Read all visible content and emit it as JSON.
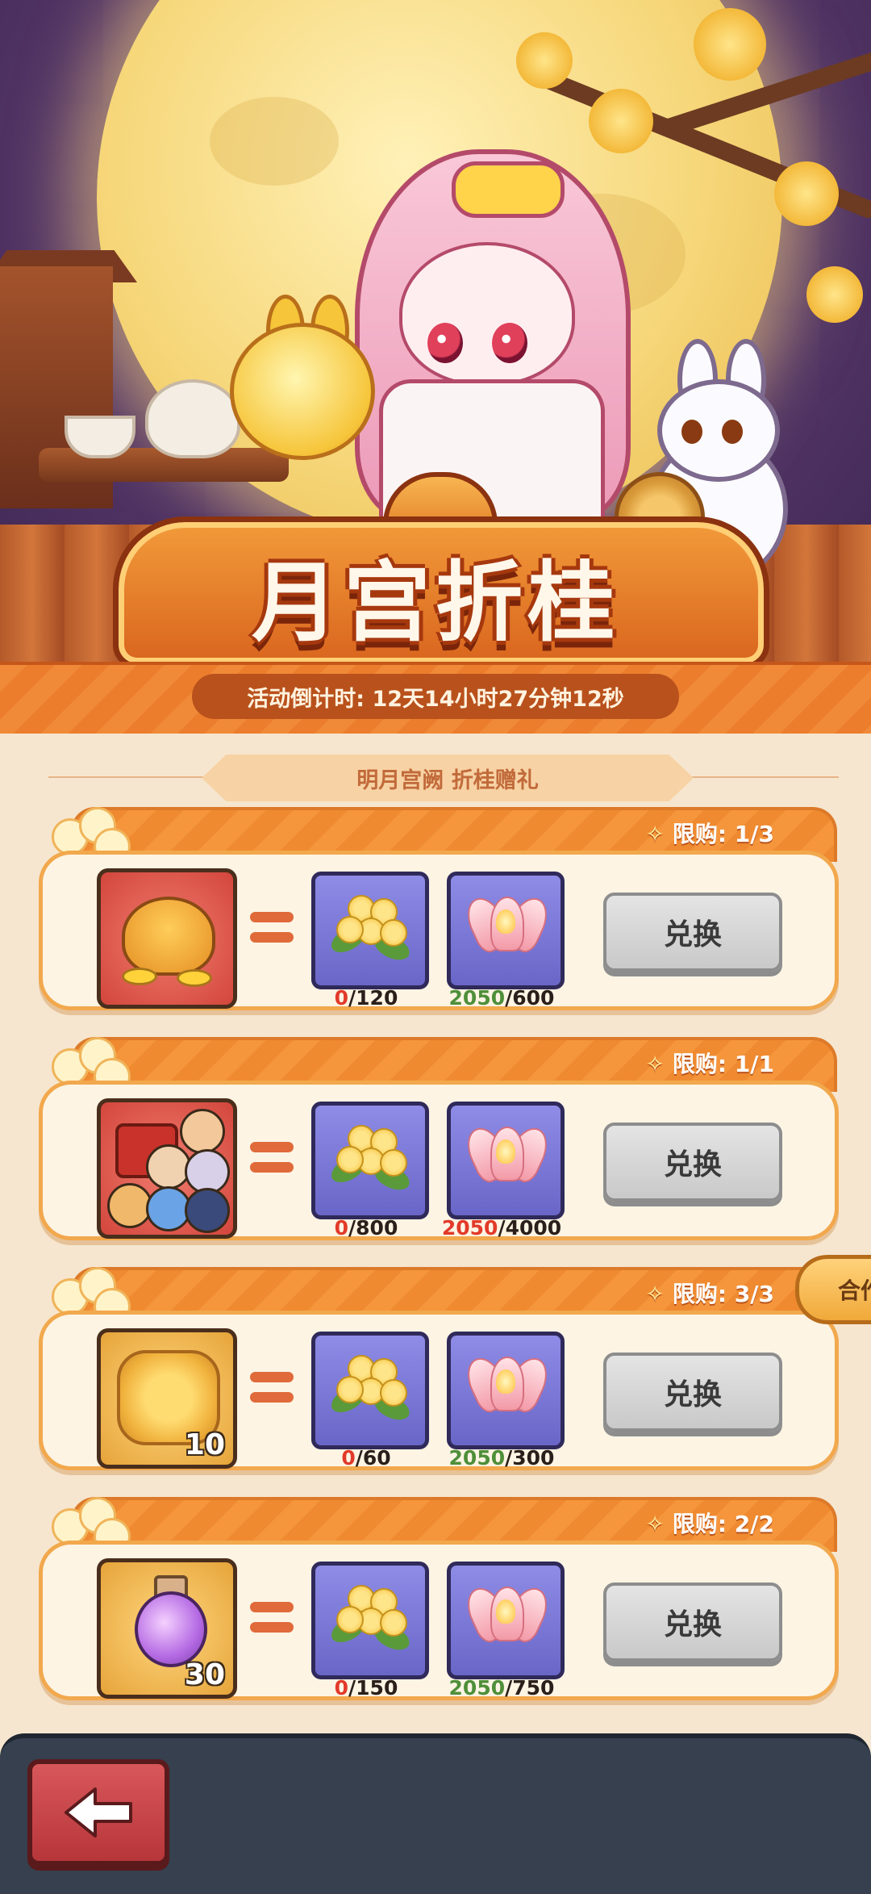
{
  "banner": {
    "title": "月宫折桂"
  },
  "countdown": {
    "text": "活动倒计时: 12天14小时27分钟12秒"
  },
  "subtitle": "明月宫阙  折桂赠礼",
  "exchange_items": [
    {
      "limit": "限购: 1/3",
      "reward_icon": "golden-toad-icon",
      "reward_count": "",
      "materials": [
        {
          "icon": "osmanthus-icon",
          "have": "0",
          "need": "/120",
          "have_color": "red"
        },
        {
          "icon": "lotus-lantern-icon",
          "have": "2050",
          "need": "/600",
          "have_color": "green"
        }
      ],
      "button": "兑换"
    },
    {
      "limit": "限购: 1/1",
      "reward_icon": "hero-chest-icon",
      "reward_count": "",
      "materials": [
        {
          "icon": "osmanthus-icon",
          "have": "0",
          "need": "/800",
          "have_color": "red"
        },
        {
          "icon": "lotus-lantern-icon",
          "have": "2050",
          "need": "/4000",
          "have_color": "red"
        }
      ],
      "button": "兑换"
    },
    {
      "limit": "限购: 3/3",
      "reward_icon": "mooncake-icon",
      "reward_count": "10",
      "materials": [
        {
          "icon": "osmanthus-icon",
          "have": "0",
          "need": "/60",
          "have_color": "red"
        },
        {
          "icon": "lotus-lantern-icon",
          "have": "2050",
          "need": "/300",
          "have_color": "green"
        }
      ],
      "button": "兑换"
    },
    {
      "limit": "限购: 2/2",
      "reward_icon": "potion-icon",
      "reward_count": "30",
      "materials": [
        {
          "icon": "osmanthus-icon",
          "have": "0",
          "need": "/150",
          "have_color": "red"
        },
        {
          "icon": "lotus-lantern-icon",
          "have": "2050",
          "need": "/750",
          "have_color": "green"
        }
      ],
      "button": "兑换"
    }
  ],
  "side_tab": "合作",
  "colors": {
    "accent_orange": "#f08a38",
    "red_text": "#e23a2a",
    "green_text": "#4e8f3a",
    "button_gray": "#c9c9c9",
    "bottom_bar": "#36404e"
  },
  "back_button_icon": "back-arrow-icon"
}
